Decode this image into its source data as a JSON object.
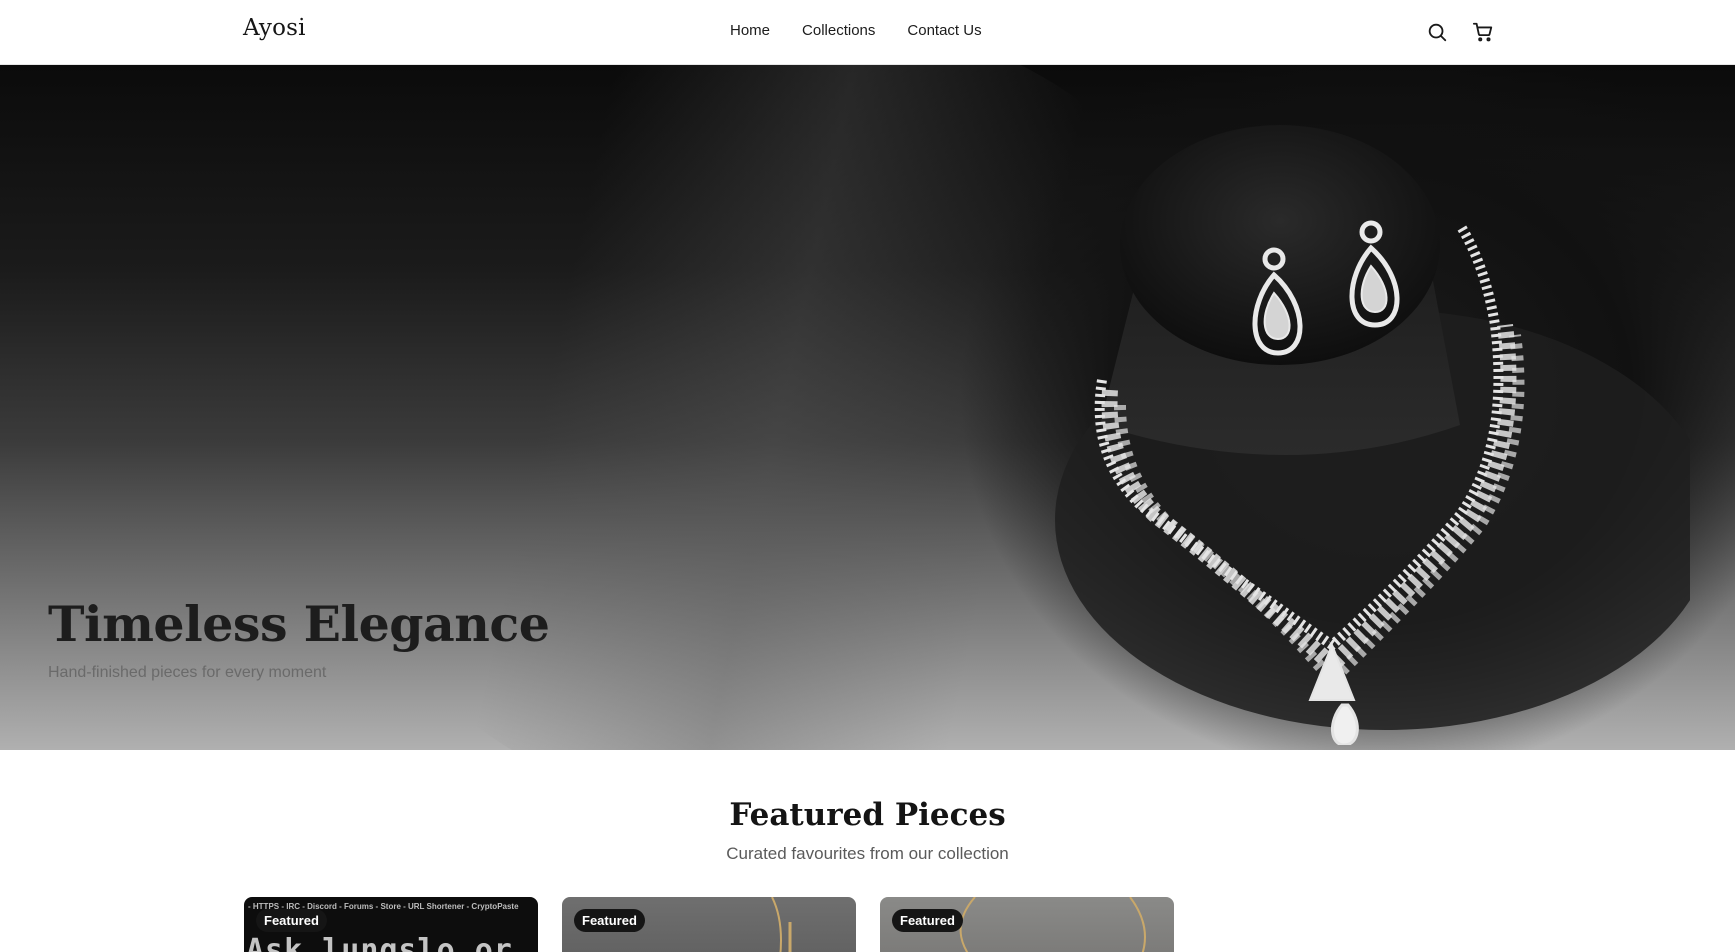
{
  "header": {
    "brand": "Ayosi",
    "nav": [
      {
        "label": "Home"
      },
      {
        "label": "Collections"
      },
      {
        "label": "Contact Us"
      }
    ],
    "icons": [
      "search-icon",
      "cart-icon"
    ]
  },
  "hero": {
    "title": "Timeless Elegance",
    "subtitle": "Hand-finished pieces for every moment"
  },
  "featured": {
    "title": "Featured Pieces",
    "subtitle": "Curated favourites from our collection",
    "cards": [
      {
        "badge": "Featured",
        "overlay_top": "- HTTPS - IRC - Discord - Forums - Store - URL Shortener - CryptoPaste",
        "overlay_big": "Ask_lungslo.or"
      },
      {
        "badge": "Featured"
      },
      {
        "badge": "Featured"
      }
    ]
  }
}
